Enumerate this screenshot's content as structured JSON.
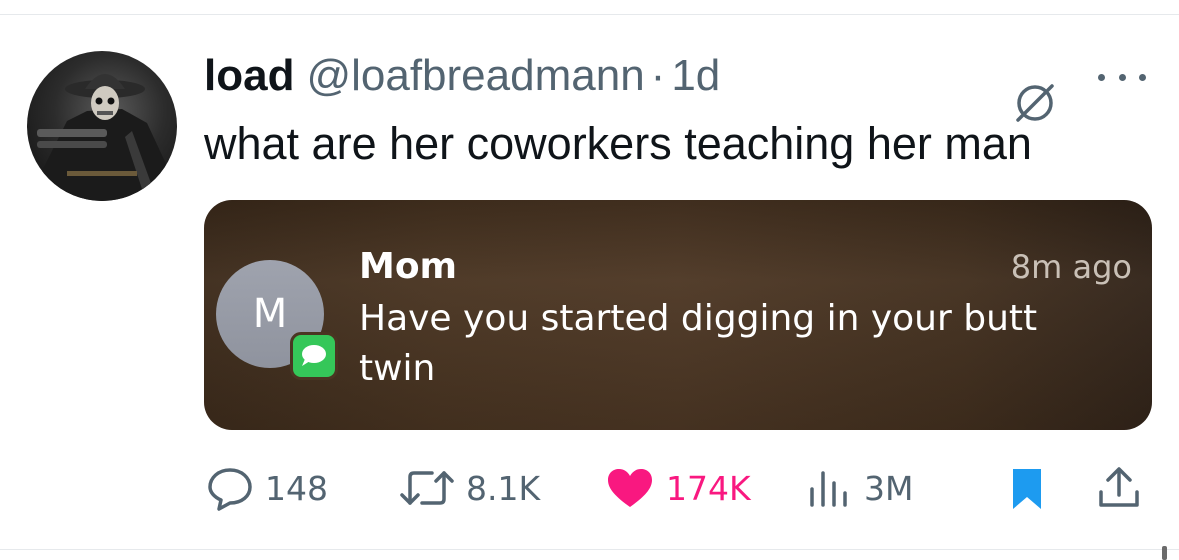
{
  "tweet": {
    "display_name": "load",
    "handle": "@loafbreadmann",
    "separator": "·",
    "time": "1d",
    "text": "what are her coworkers teaching her man"
  },
  "media": {
    "notification": {
      "avatar_letter": "M",
      "sender": "Mom",
      "time": "8m ago",
      "body": "Have you started digging in your butt twin"
    }
  },
  "actions": {
    "replies": "148",
    "reposts": "8.1K",
    "likes": "174K",
    "views": "3M"
  },
  "colors": {
    "like": "#f91880",
    "bookmark": "#1d9bf0",
    "muted": "#536471",
    "messages_green": "#35c759"
  },
  "icons": [
    "grok-icon",
    "more-icon",
    "reply-icon",
    "repost-icon",
    "like-icon",
    "views-icon",
    "bookmark-icon",
    "share-icon",
    "messages-app-icon"
  ]
}
